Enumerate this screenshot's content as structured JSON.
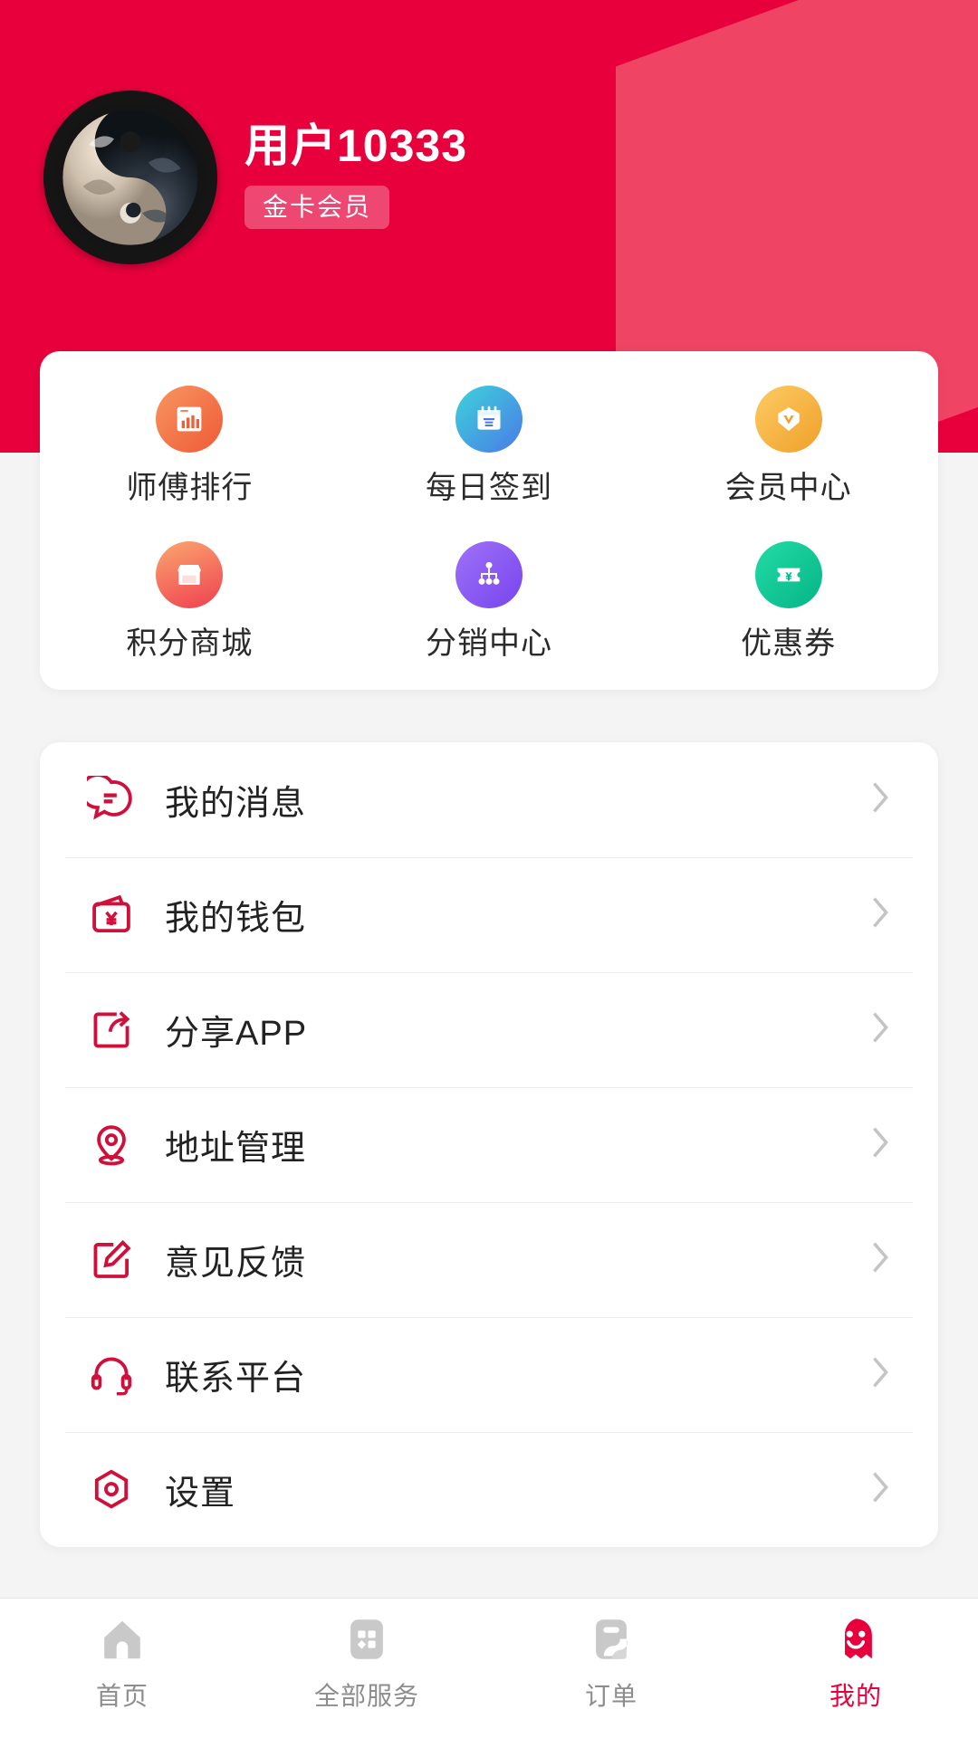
{
  "theme": {
    "brand_red": "#e8003c",
    "brand_red_light": "#ef4464",
    "card_white": "#ffffff",
    "page_bg": "#f4f4f4",
    "muted_gray": "#8d8d8d"
  },
  "header": {
    "username": "用户10333",
    "badge_label": "金卡会员",
    "avatar_icon": "yin-yang-avatar"
  },
  "quick_grid": {
    "rows": [
      [
        {
          "label": "师傅排行",
          "icon": "bar-chart-icon",
          "color_start": "#f98a5a",
          "color_end": "#ef5f3c"
        },
        {
          "label": "每日签到",
          "icon": "calendar-check-icon",
          "color_start": "#3fd0d8",
          "color_end": "#4a7ce8"
        },
        {
          "label": "会员中心",
          "icon": "diamond-vip-icon",
          "color_start": "#fcc champion",
          "color_end": "#f0a02a"
        }
      ],
      [
        {
          "label": "积分商城",
          "icon": "shop-store-icon",
          "color_start": "#fba06a",
          "color_end": "#ef3f4f"
        },
        {
          "label": "分销中心",
          "icon": "hierarchy-network-icon",
          "color_start": "#9a6cf5",
          "color_end": "#7a46ef"
        },
        {
          "label": "优惠券",
          "icon": "coupon-ticket-icon",
          "color_start": "#1ed6a0",
          "color_end": "#07b98a"
        }
      ]
    ]
  },
  "menu": {
    "items": [
      {
        "label": "我的消息",
        "icon": "chat-bubble-icon",
        "chevron": "›"
      },
      {
        "label": "我的钱包",
        "icon": "wallet-yuan-icon",
        "chevron": "›"
      },
      {
        "label": "分享APP",
        "icon": "share-export-icon",
        "chevron": "›"
      },
      {
        "label": "地址管理",
        "icon": "location-pin-icon",
        "chevron": "›"
      },
      {
        "label": "意见反馈",
        "icon": "edit-pencil-icon",
        "chevron": "›"
      },
      {
        "label": "联系平台",
        "icon": "headset-support-icon",
        "chevron": "›"
      },
      {
        "label": "设置",
        "icon": "settings-hexagon-icon",
        "chevron": "›"
      }
    ]
  },
  "tabbar": {
    "tabs": [
      {
        "label": "首页",
        "icon": "home-icon",
        "active": false
      },
      {
        "label": "全部服务",
        "icon": "grid-services-icon",
        "active": false
      },
      {
        "label": "订单",
        "icon": "order-list-icon",
        "active": false
      },
      {
        "label": "我的",
        "icon": "profile-smiley-icon",
        "active": true
      }
    ]
  }
}
